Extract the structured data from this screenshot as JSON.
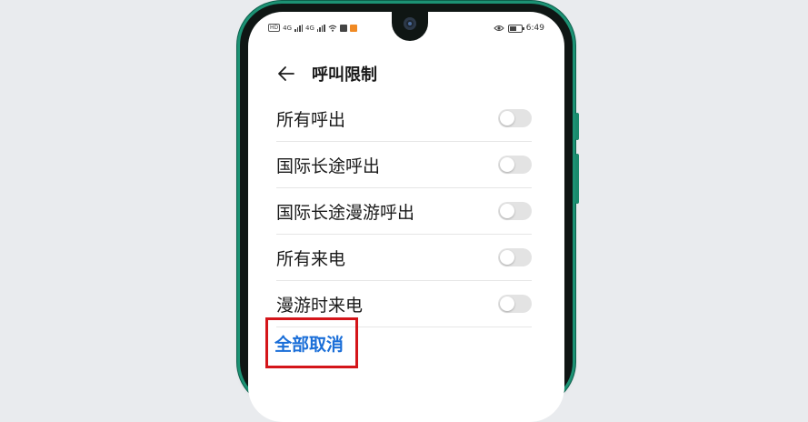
{
  "status_bar": {
    "left_badges": [
      "HD",
      "4G",
      "4G"
    ],
    "time": "6:49"
  },
  "header": {
    "title": "呼叫限制"
  },
  "settings": [
    {
      "label": "所有呼出",
      "on": false
    },
    {
      "label": "国际长途呼出",
      "on": false
    },
    {
      "label": "国际长途漫游呼出",
      "on": false
    },
    {
      "label": "所有来电",
      "on": false
    },
    {
      "label": "漫游时来电",
      "on": false
    }
  ],
  "actions": {
    "cancel_all": "全部取消"
  },
  "colors": {
    "accent": "#1a6ed8",
    "highlight": "#d4151a",
    "phone_frame": "#1c9274"
  }
}
